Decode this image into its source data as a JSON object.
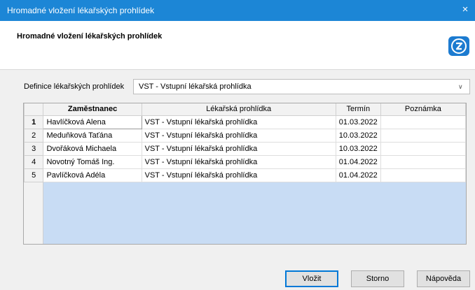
{
  "window": {
    "title": "Hromadné vložení lékařských prohlídek",
    "close_glyph": "×"
  },
  "header": {
    "title": "Hromadné vložení lékařských prohlídek",
    "logo_icon": "help-logo-icon"
  },
  "definition": {
    "label": "Definice lékařských prohlídek",
    "selected": "VST - Vstupní lékařská prohlídka"
  },
  "grid": {
    "columns": [
      "Zaměstnanec",
      "Lékařská prohlídka",
      "Termín",
      "Poznámka"
    ],
    "rows": [
      {
        "num": "1",
        "employee": "Havlíčková Alena",
        "exam": "VST - Vstupní lékařská prohlídka",
        "date": "01.03.2022",
        "note": ""
      },
      {
        "num": "2",
        "employee": "Meduňková Taťána",
        "exam": "VST - Vstupní lékařská prohlídka",
        "date": "10.03.2022",
        "note": ""
      },
      {
        "num": "3",
        "employee": "Dvořáková Michaela",
        "exam": "VST - Vstupní lékařská prohlídka",
        "date": "10.03.2022",
        "note": ""
      },
      {
        "num": "4",
        "employee": "Novotný Tomáš Ing.",
        "exam": "VST - Vstupní lékařská prohlídka",
        "date": "01.04.2022",
        "note": ""
      },
      {
        "num": "5",
        "employee": "Pavlíčková Adéla",
        "exam": "VST - Vstupní lékařská prohlídka",
        "date": "01.04.2022",
        "note": ""
      }
    ]
  },
  "buttons": {
    "insert": "Vložit",
    "cancel": "Storno",
    "help": "Nápověda"
  },
  "colors": {
    "titlebar": "#1c86d6",
    "grid_empty": "#c8dcf4",
    "primary_border": "#0078d7"
  }
}
